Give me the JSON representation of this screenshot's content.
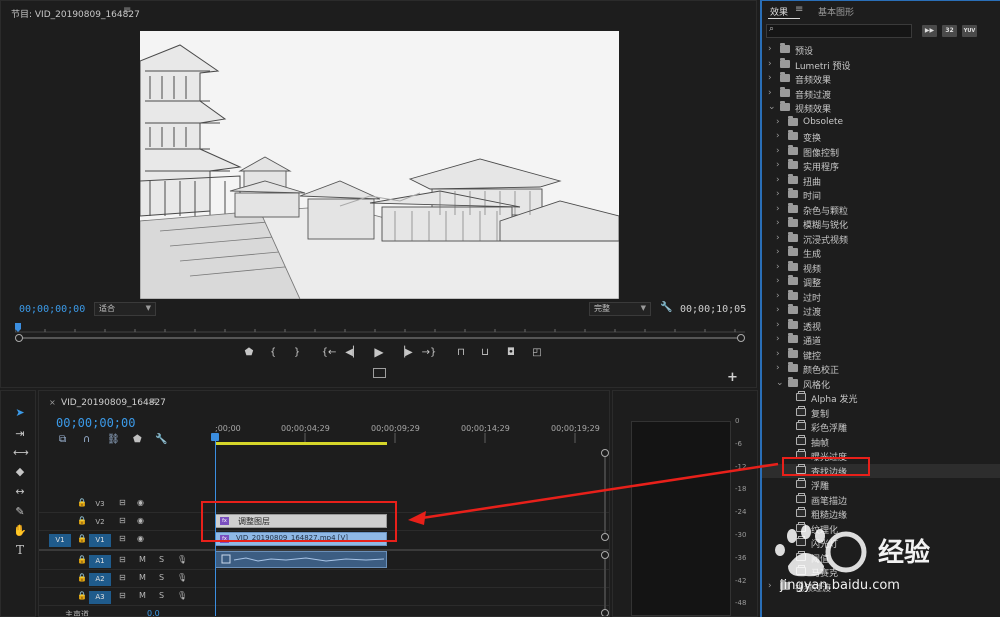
{
  "program": {
    "title": "节目: VID_20190809_164827",
    "menu_icon": "≡",
    "timecode_left": "00;00;00;00",
    "fit_label": "适合",
    "quality_label": "完整",
    "timecode_right": "00;00;10;05"
  },
  "effects_panel": {
    "tab_effects": "效果",
    "tab_menu": "≡",
    "tab_graphics": "基本图形",
    "button_32": "32",
    "button_yuv": "YUV",
    "items": [
      {
        "label": "预设",
        "level": 0,
        "expanded": false,
        "icon": "folder"
      },
      {
        "label": "Lumetri 预设",
        "level": 0,
        "expanded": false,
        "icon": "folder"
      },
      {
        "label": "音频效果",
        "level": 0,
        "expanded": false,
        "icon": "folder"
      },
      {
        "label": "音频过渡",
        "level": 0,
        "expanded": false,
        "icon": "folder"
      },
      {
        "label": "视频效果",
        "level": 0,
        "expanded": true,
        "icon": "folder"
      },
      {
        "label": "Obsolete",
        "level": 1,
        "expanded": false,
        "icon": "folder"
      },
      {
        "label": "变换",
        "level": 1,
        "expanded": false,
        "icon": "folder"
      },
      {
        "label": "图像控制",
        "level": 1,
        "expanded": false,
        "icon": "folder"
      },
      {
        "label": "实用程序",
        "level": 1,
        "expanded": false,
        "icon": "folder"
      },
      {
        "label": "扭曲",
        "level": 1,
        "expanded": false,
        "icon": "folder"
      },
      {
        "label": "时间",
        "level": 1,
        "expanded": false,
        "icon": "folder"
      },
      {
        "label": "杂色与颗粒",
        "level": 1,
        "expanded": false,
        "icon": "folder"
      },
      {
        "label": "模糊与锐化",
        "level": 1,
        "expanded": false,
        "icon": "folder"
      },
      {
        "label": "沉浸式视频",
        "level": 1,
        "expanded": false,
        "icon": "folder"
      },
      {
        "label": "生成",
        "level": 1,
        "expanded": false,
        "icon": "folder"
      },
      {
        "label": "视频",
        "level": 1,
        "expanded": false,
        "icon": "folder"
      },
      {
        "label": "调整",
        "level": 1,
        "expanded": false,
        "icon": "folder"
      },
      {
        "label": "过时",
        "level": 1,
        "expanded": false,
        "icon": "folder"
      },
      {
        "label": "过渡",
        "level": 1,
        "expanded": false,
        "icon": "folder"
      },
      {
        "label": "透视",
        "level": 1,
        "expanded": false,
        "icon": "folder"
      },
      {
        "label": "通道",
        "level": 1,
        "expanded": false,
        "icon": "folder"
      },
      {
        "label": "键控",
        "level": 1,
        "expanded": false,
        "icon": "folder"
      },
      {
        "label": "颜色校正",
        "level": 1,
        "expanded": false,
        "icon": "folder"
      },
      {
        "label": "风格化",
        "level": 1,
        "expanded": true,
        "icon": "folder"
      },
      {
        "label": "Alpha 发光",
        "level": 2,
        "icon": "effect"
      },
      {
        "label": "复制",
        "level": 2,
        "icon": "effect"
      },
      {
        "label": "彩色浮雕",
        "level": 2,
        "icon": "effect"
      },
      {
        "label": "抽帧",
        "level": 2,
        "icon": "effect"
      },
      {
        "label": "曝光过度",
        "level": 2,
        "icon": "effect"
      },
      {
        "label": "查找边缘",
        "level": 2,
        "icon": "effect",
        "selected": true
      },
      {
        "label": "浮雕",
        "level": 2,
        "icon": "effect"
      },
      {
        "label": "画笔描边",
        "level": 2,
        "icon": "effect"
      },
      {
        "label": "粗糙边缘",
        "level": 2,
        "icon": "effect"
      },
      {
        "label": "纹理化",
        "level": 2,
        "icon": "effect"
      },
      {
        "label": "闪光灯",
        "level": 2,
        "icon": "effect"
      },
      {
        "label": "阈值",
        "level": 2,
        "icon": "effect"
      },
      {
        "label": "马赛克",
        "level": 2,
        "icon": "effect"
      },
      {
        "label": "视频过渡",
        "level": 0,
        "expanded": false,
        "icon": "folder"
      }
    ]
  },
  "timeline": {
    "close": "×",
    "title": "VID_20190809_164827",
    "menu_icon": "≡",
    "timecode": "00;00;00;00",
    "ruler_labels": [
      ";00;00",
      "00;00;04;29",
      "00;00;09;29",
      "00;00;14;29",
      "00;00;19;29"
    ],
    "tracks": {
      "v3": "V3",
      "v2": "V2",
      "v1": "V1",
      "v1_src": "V1",
      "a1": "A1",
      "a2": "A2",
      "a3": "A3",
      "a1_src": "A1",
      "m": "M",
      "s": "S",
      "master": "主声道",
      "master_value": "0.0"
    },
    "clip_adjust_label": "调整图层",
    "clip_video_label": "VID_20190809_164827.mp4 [V]",
    "fx_badge": "fx"
  },
  "vu_meter": {
    "scale": [
      "0",
      "-6",
      "-12",
      "-18",
      "-24",
      "-30",
      "-36",
      "-42",
      "-48"
    ]
  },
  "watermark": {
    "brand_text": "经验",
    "url": "jingyan.baidu.com"
  },
  "colors": {
    "accent_blue": "#3b9ae8",
    "annotation_red": "#e8201a",
    "video_clip": "#8fb9e6",
    "adjust_clip": "#cfcfcf"
  }
}
